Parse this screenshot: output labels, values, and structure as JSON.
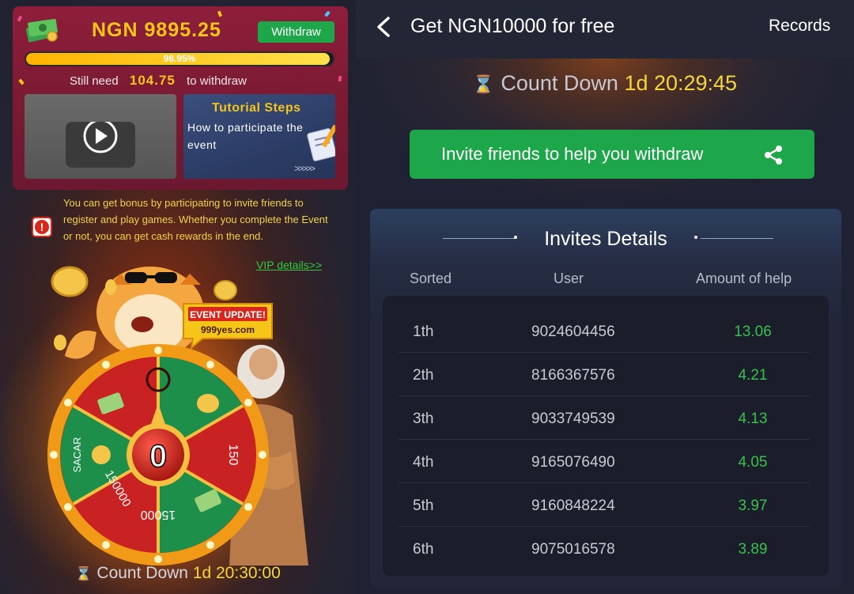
{
  "left": {
    "balance": "NGN 9895.25",
    "withdraw_label": "Withdraw",
    "progress_text": "98.95%",
    "progress_value": 98.95,
    "still_need_prefix": "Still need",
    "still_need_amount": "104.75",
    "still_need_suffix": "to withdraw",
    "tutorial_title": "Tutorial Steps",
    "tutorial_sub": "How to participate the event",
    "tutorial_arrows": ">>>>>",
    "notice": "You can get bonus by participating to invite friends to register and play games. Whether you complete the Event or not, you can get cash rewards in the end.",
    "vip_link": "VIP details>>",
    "event_badge_line1": "EVENT UPDATE!",
    "event_badge_line2": "999yes.com",
    "wheel_center": "0",
    "wheel_labels": [
      "150",
      "15000",
      "150000",
      "SACAR"
    ],
    "countdown_label": "Count Down",
    "countdown_time": "1d 20:30:00",
    "alert_glyph": "!",
    "hourglass_glyph": "⌛"
  },
  "right": {
    "title": "Get NGN10000 for free",
    "records": "Records",
    "countdown_label": "Count Down",
    "countdown_time": "1d 20:29:45",
    "hourglass_glyph": "⌛",
    "invite_button": "Invite friends to help you withdraw",
    "invites_title": "Invites Details",
    "columns": [
      "Sorted",
      "User",
      "Amount of help"
    ],
    "rows": [
      {
        "rank": "1th",
        "user": "9024604456",
        "amount": "13.06"
      },
      {
        "rank": "2th",
        "user": "8166367576",
        "amount": "4.21"
      },
      {
        "rank": "3th",
        "user": "9033749539",
        "amount": "4.13"
      },
      {
        "rank": "4th",
        "user": "9165076490",
        "amount": "4.05"
      },
      {
        "rank": "5th",
        "user": "9160848224",
        "amount": "3.97"
      },
      {
        "rank": "6th",
        "user": "9075016578",
        "amount": "3.89"
      }
    ]
  },
  "colors": {
    "accent_green": "#1ea64a",
    "gold": "#f5c518",
    "amount_green": "#34c24a",
    "card_red": "#8e1e3a"
  },
  "icons": [
    "money-stack-icon",
    "play-icon",
    "notepad-icon",
    "alert-icon",
    "hourglass-icon",
    "back-chevron-icon",
    "share-icon"
  ]
}
